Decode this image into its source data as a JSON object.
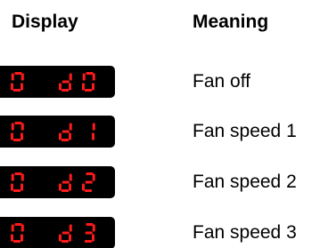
{
  "headers": {
    "display": "Display",
    "meaning": "Meaning"
  },
  "segment_color": "#ff1a1a",
  "panel_color": "#000000",
  "rows": [
    {
      "display": "0  d0",
      "digits": [
        "0",
        "d",
        "0"
      ],
      "meaning": "Fan off"
    },
    {
      "display": "0  d1",
      "digits": [
        "0",
        "d",
        "1"
      ],
      "meaning": "Fan speed 1"
    },
    {
      "display": "0  d2",
      "digits": [
        "0",
        "d",
        "2"
      ],
      "meaning": "Fan speed 2"
    },
    {
      "display": "0  d3",
      "digits": [
        "0",
        "d",
        "3"
      ],
      "meaning": "Fan speed 3"
    }
  ]
}
